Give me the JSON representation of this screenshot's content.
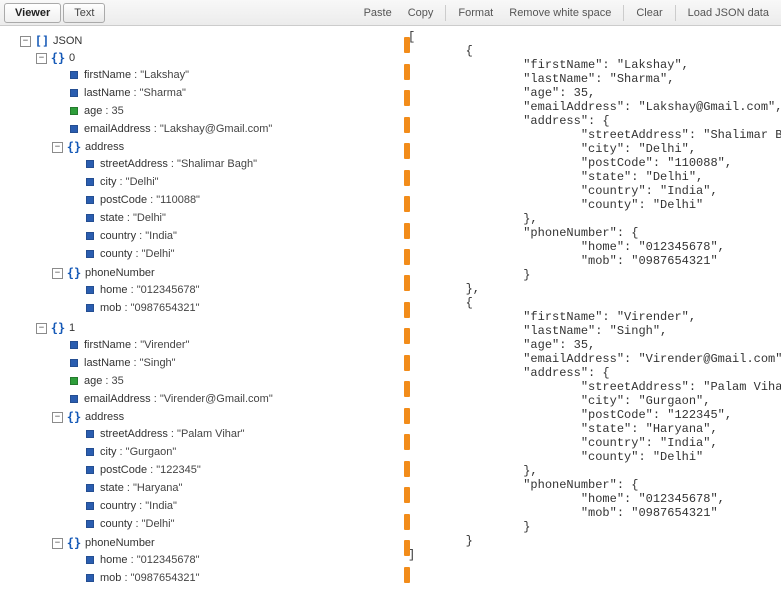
{
  "toolbar": {
    "tabs": {
      "viewer": "Viewer",
      "text": "Text"
    },
    "buttons": {
      "paste": "Paste",
      "copy": "Copy",
      "format": "Format",
      "removeWs": "Remove white space",
      "clear": "Clear",
      "load": "Load JSON data"
    }
  },
  "tree": {
    "rootLabel": "JSON",
    "idx0": "0",
    "idx1": "1",
    "keys": {
      "firstName": "firstName",
      "lastName": "lastName",
      "age": "age",
      "emailAddress": "emailAddress",
      "address": "address",
      "streetAddress": "streetAddress",
      "city": "city",
      "postCode": "postCode",
      "state": "state",
      "country": "country",
      "county": "county",
      "phoneNumber": "phoneNumber",
      "home": "home",
      "mob": "mob"
    },
    "v0": {
      "firstName": "\"Lakshay\"",
      "lastName": "\"Sharma\"",
      "age": "35",
      "emailAddress": "\"Lakshay@Gmail.com\"",
      "address": {
        "streetAddress": "\"Shalimar Bagh\"",
        "city": "\"Delhi\"",
        "postCode": "\"110088\"",
        "state": "\"Delhi\"",
        "country": "\"India\"",
        "county": "\"Delhi\""
      },
      "phone": {
        "home": "\"012345678\"",
        "mob": "\"0987654321\""
      }
    },
    "v1": {
      "firstName": "\"Virender\"",
      "lastName": "\"Singh\"",
      "age": "35",
      "emailAddress": "\"Virender@Gmail.com\"",
      "address": {
        "streetAddress": "\"Palam Vihar\"",
        "city": "\"Gurgaon\"",
        "postCode": "\"122345\"",
        "state": "\"Haryana\"",
        "country": "\"India\"",
        "county": "\"Delhi\""
      },
      "phone": {
        "home": "\"012345678\"",
        "mob": "\"0987654321\""
      }
    }
  },
  "jsonText": "[\n        {\n                \"firstName\": \"Lakshay\",\n                \"lastName\": \"Sharma\",\n                \"age\": 35,\n                \"emailAddress\": \"Lakshay@Gmail.com\",\n                \"address\": {\n                        \"streetAddress\": \"Shalimar Bagh\",\n                        \"city\": \"Delhi\",\n                        \"postCode\": \"110088\",\n                        \"state\": \"Delhi\",\n                        \"country\": \"India\",\n                        \"county\": \"Delhi\"\n                },\n                \"phoneNumber\": {\n                        \"home\": \"012345678\",\n                        \"mob\": \"0987654321\"\n                }\n        },\n        {\n                \"firstName\": \"Virender\",\n                \"lastName\": \"Singh\",\n                \"age\": 35,\n                \"emailAddress\": \"Virender@Gmail.com\",\n                \"address\": {\n                        \"streetAddress\": \"Palam Vihar\",\n                        \"city\": \"Gurgaon\",\n                        \"postCode\": \"122345\",\n                        \"state\": \"Haryana\",\n                        \"country\": \"India\",\n                        \"county\": \"Delhi\"\n                },\n                \"phoneNumber\": {\n                        \"home\": \"012345678\",\n                        \"mob\": \"0987654321\"\n                }\n        }\n]"
}
